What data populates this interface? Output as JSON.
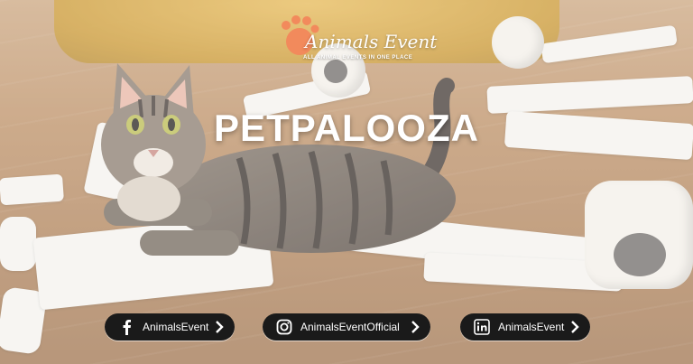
{
  "brand": {
    "name": "Animals Event",
    "tagline": "ALL ANIMAL EVENTS IN ONE PLACE",
    "logo_icon": "paw-icon",
    "accent": "#f28a5c"
  },
  "event": {
    "title": "PETPALOOZA"
  },
  "socials": [
    {
      "icon": "facebook-icon",
      "label": "AnimalsEvent"
    },
    {
      "icon": "instagram-icon",
      "label": "AnimalsEventOfficial"
    },
    {
      "icon": "linkedin-icon",
      "label": "AnimalsEvent"
    }
  ]
}
